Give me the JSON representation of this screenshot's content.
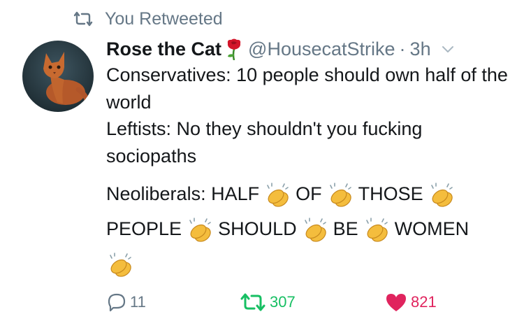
{
  "context": {
    "label": "You Retweeted",
    "icon": "retweet-icon"
  },
  "tweet": {
    "display_name": "Rose the Cat",
    "name_emoji": "rose-icon",
    "handle": "@HousecatStrike",
    "separator": "·",
    "time": "3h",
    "lines": {
      "line1": "Conservatives: 10 people should own half of the world",
      "line2": "Leftists: No they shouldn't you fucking sociopaths"
    },
    "clap_words": {
      "w1": "Neoliberals: HALF",
      "w2": "OF",
      "w3": "THOSE",
      "w4": "PEOPLE",
      "w5": "SHOULD",
      "w6": "BE",
      "w7": "WOMEN"
    }
  },
  "actions": {
    "replies": "11",
    "retweets": "307",
    "likes": "821"
  },
  "colors": {
    "retweet_green": "#17bf63",
    "like_red": "#e0245e",
    "muted_gray": "#657786",
    "text": "#14171a"
  }
}
